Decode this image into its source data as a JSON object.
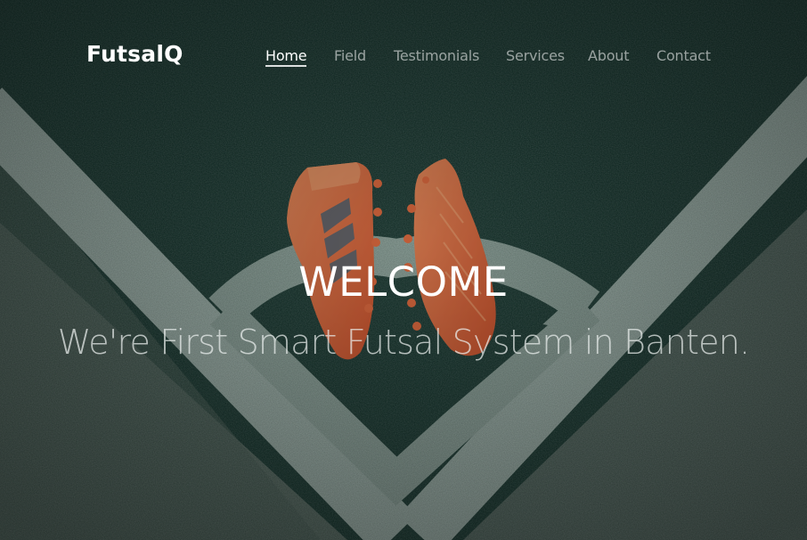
{
  "brand": {
    "name": "FutsalQ"
  },
  "nav": {
    "items": [
      {
        "label": "Home",
        "active": true
      },
      {
        "label": "Field",
        "active": false
      },
      {
        "label": "Testimonials",
        "active": false
      },
      {
        "label": "Services",
        "active": false
      },
      {
        "label": "About",
        "active": false
      },
      {
        "label": "Contact",
        "active": false
      }
    ]
  },
  "hero": {
    "heading": "WELCOME",
    "subheading": "We're First Smart Futsal System in Banten."
  },
  "colors": {
    "turf": "#1c3a33",
    "field_line": "#a8bdb6",
    "boots": "#e8683c",
    "text": "#ffffff"
  }
}
